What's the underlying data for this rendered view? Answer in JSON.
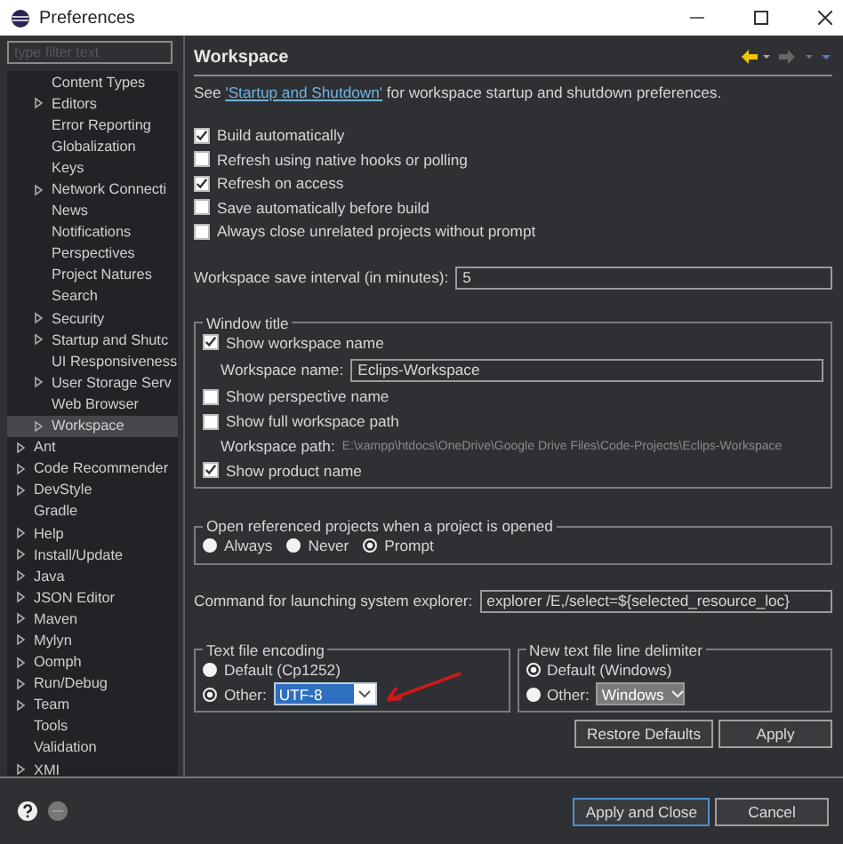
{
  "window": {
    "title": "Preferences"
  },
  "filter": {
    "placeholder": "type filter text"
  },
  "tree": [
    {
      "children": [
        {
          "label": "Content Types",
          "expandable": false,
          "selected": false
        },
        {
          "label": "Editors",
          "expandable": true,
          "selected": false
        },
        {
          "label": "Error Reporting",
          "expandable": false,
          "selected": false
        },
        {
          "label": "Globalization",
          "expandable": false,
          "selected": false
        },
        {
          "label": "Keys",
          "expandable": false,
          "selected": false
        },
        {
          "label": "Network Connecti",
          "expandable": true,
          "selected": false
        },
        {
          "label": "News",
          "expandable": false,
          "selected": false
        },
        {
          "label": "Notifications",
          "expandable": false,
          "selected": false
        },
        {
          "label": "Perspectives",
          "expandable": false,
          "selected": false
        },
        {
          "label": "Project Natures",
          "expandable": false,
          "selected": false
        },
        {
          "label": "Search",
          "expandable": false,
          "selected": false
        },
        {
          "label": "Security",
          "expandable": true,
          "selected": false
        },
        {
          "label": "Startup and Shutc",
          "expandable": true,
          "selected": false
        },
        {
          "label": "UI Responsiveness",
          "expandable": false,
          "selected": false
        },
        {
          "label": "User Storage Serv",
          "expandable": true,
          "selected": false
        },
        {
          "label": "Web Browser",
          "expandable": false,
          "selected": false
        },
        {
          "label": "Workspace",
          "expandable": true,
          "selected": true
        }
      ]
    },
    {
      "label": "Ant",
      "expandable": true,
      "selected": false
    },
    {
      "label": "Code Recommender",
      "expandable": true,
      "selected": false
    },
    {
      "label": "DevStyle",
      "expandable": true,
      "selected": false
    },
    {
      "label": "Gradle",
      "expandable": false,
      "selected": false
    },
    {
      "label": "Help",
      "expandable": true,
      "selected": false
    },
    {
      "label": "Install/Update",
      "expandable": true,
      "selected": false
    },
    {
      "label": "Java",
      "expandable": true,
      "selected": false
    },
    {
      "label": "JSON Editor",
      "expandable": true,
      "selected": false
    },
    {
      "label": "Maven",
      "expandable": true,
      "selected": false
    },
    {
      "label": "Mylyn",
      "expandable": true,
      "selected": false
    },
    {
      "label": "Oomph",
      "expandable": true,
      "selected": false
    },
    {
      "label": "Run/Debug",
      "expandable": true,
      "selected": false
    },
    {
      "label": "Team",
      "expandable": true,
      "selected": false
    },
    {
      "label": "Tools",
      "expandable": false,
      "selected": false
    },
    {
      "label": "Validation",
      "expandable": false,
      "selected": false
    },
    {
      "label": "XMI",
      "expandable": true,
      "selected": false
    }
  ],
  "page": {
    "title": "Workspace",
    "intro": {
      "before": "See ",
      "link": "'Startup and Shutdown'",
      "after": " for workspace startup and shutdown preferences."
    },
    "options": [
      {
        "label": "Build automatically",
        "checked": true
      },
      {
        "label": "Refresh using native hooks or polling",
        "checked": false
      },
      {
        "label": "Refresh on access",
        "checked": true
      },
      {
        "label": "Save automatically before build",
        "checked": false
      },
      {
        "label": "Always close unrelated projects without prompt",
        "checked": false
      }
    ],
    "save_interval": {
      "label": "Workspace save interval (in minutes):",
      "value": "5"
    },
    "window_title": {
      "legend": "Window title",
      "show_name": {
        "label": "Show workspace name",
        "checked": true
      },
      "name": {
        "label": "Workspace name:",
        "value": "Eclips-Workspace"
      },
      "show_perspective": {
        "label": "Show perspective name",
        "checked": false
      },
      "show_path": {
        "label": "Show full workspace path",
        "checked": false
      },
      "path": {
        "label": "Workspace path:",
        "value": "E:\\xampp\\htdocs\\OneDrive\\Google Drive Files\\Code-Projects\\Eclips-Workspace"
      },
      "show_product": {
        "label": "Show product name",
        "checked": true
      }
    },
    "open_referenced": {
      "legend": "Open referenced projects when a project is opened",
      "choices": [
        {
          "label": "Always",
          "selected": false
        },
        {
          "label": "Never",
          "selected": false
        },
        {
          "label": "Prompt",
          "selected": true
        }
      ]
    },
    "explorer": {
      "label": "Command for launching system explorer:",
      "value": "explorer /E,/select=${selected_resource_loc}"
    },
    "encoding": {
      "legend": "Text file encoding",
      "default": {
        "label": "Default (Cp1252)",
        "selected": false
      },
      "other": {
        "label": "Other:",
        "selected": true,
        "value": "UTF-8",
        "disabled": false
      }
    },
    "delimiter": {
      "legend": "New text file line delimiter",
      "default": {
        "label": "Default (Windows)",
        "selected": true
      },
      "other": {
        "label": "Other:",
        "selected": false,
        "value": "Windows",
        "disabled": true
      }
    },
    "buttons": [
      "Restore Defaults",
      "Apply"
    ]
  },
  "footer": {
    "buttons": [
      {
        "label": "Apply and Close",
        "default": true
      },
      {
        "label": "Cancel",
        "default": false
      }
    ]
  }
}
